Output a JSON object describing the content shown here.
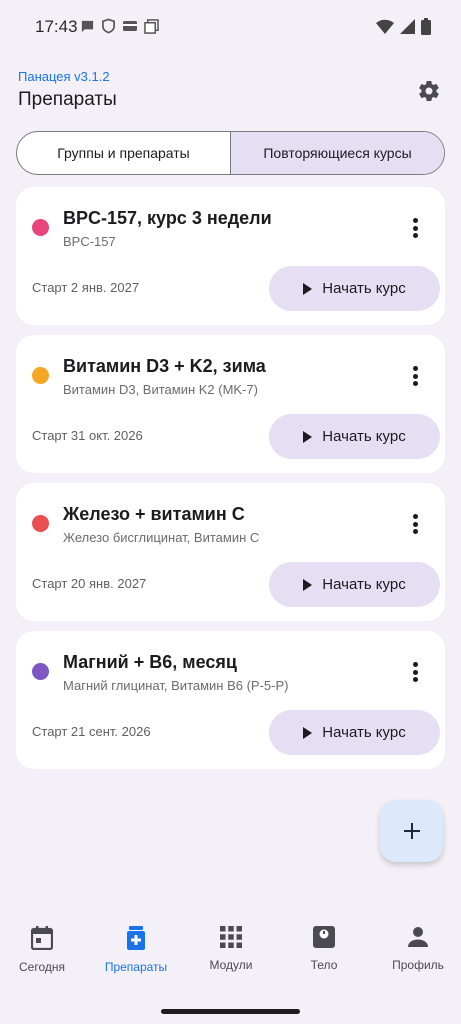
{
  "status_bar": {
    "time": "17:43"
  },
  "header": {
    "app_version": "Панацея v3.1.2",
    "title": "Препараты"
  },
  "tabs": [
    {
      "label": "Группы и препараты",
      "selected": false
    },
    {
      "label": "Повторяющиеся курсы",
      "selected": true
    }
  ],
  "courses": [
    {
      "title": "BPC-157, курс 3 недели",
      "subtitle": "BPC-157",
      "start": "Старт 2 янв. 2027",
      "button_label": "Начать курс",
      "dot_color": "#e8457a"
    },
    {
      "title": "Витамин D3 + K2, зима",
      "subtitle": "Витамин D3, Витамин K2 (MK-7)",
      "start": "Старт 31 окт. 2026",
      "button_label": "Начать курс",
      "dot_color": "#f5a623"
    },
    {
      "title": "Железо + витамин С",
      "subtitle": "Железо бисглицинат, Витамин C",
      "start": "Старт 20 янв. 2027",
      "button_label": "Начать курс",
      "dot_color": "#eb5050"
    },
    {
      "title": "Магний + B6, месяц",
      "subtitle": "Магний глицинат, Витамин B6 (P-5-P)",
      "start": "Старт 21 сент. 2026",
      "button_label": "Начать курс",
      "dot_color": "#7e57c2"
    }
  ],
  "fab": {
    "icon": "plus-icon"
  },
  "bottom_nav": [
    {
      "label": "Сегодня",
      "icon": "calendar-icon",
      "active": false
    },
    {
      "label": "Препараты",
      "icon": "medicine-icon",
      "active": true
    },
    {
      "label": "Модули",
      "icon": "grid-icon",
      "active": false
    },
    {
      "label": "Тело",
      "icon": "scale-icon",
      "active": false
    },
    {
      "label": "Профиль",
      "icon": "person-icon",
      "active": false
    }
  ],
  "colors": {
    "accent": "#1a73e8",
    "selected_tab": "#e6dff4",
    "background": "#f3f1f7"
  }
}
